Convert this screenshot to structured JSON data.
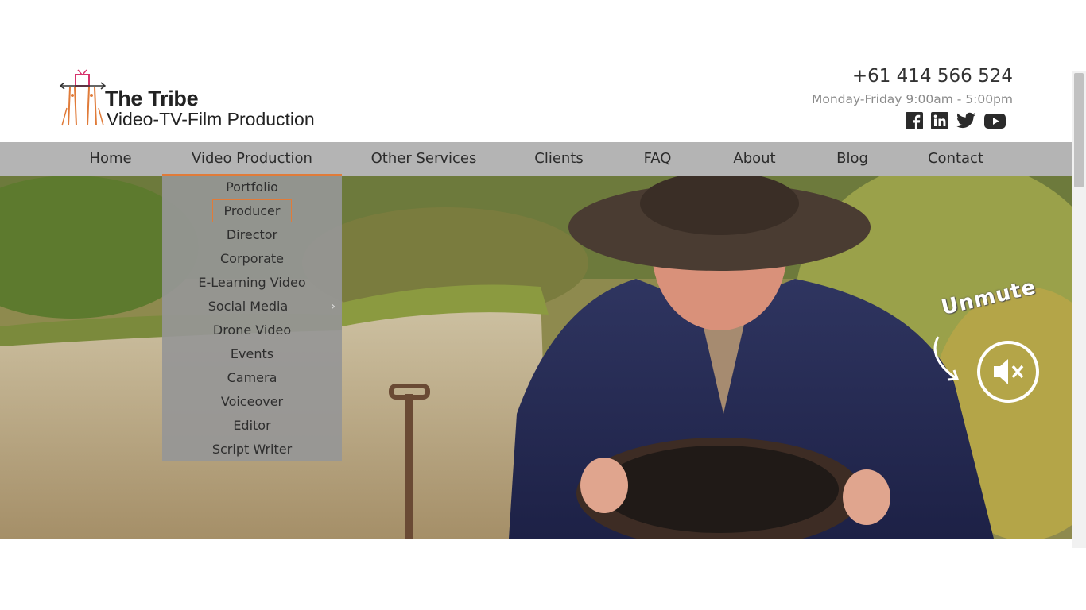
{
  "brand": {
    "title": "The Tribe",
    "subtitle": "Video-TV-Film Production",
    "logo_icon": "tribe-logo-figure"
  },
  "contact": {
    "phone": "+61 414 566 524",
    "hours": "Monday-Friday  9:00am - 5:00pm"
  },
  "social": [
    {
      "name": "facebook-icon"
    },
    {
      "name": "linkedin-icon"
    },
    {
      "name": "twitter-icon"
    },
    {
      "name": "youtube-icon"
    }
  ],
  "nav": {
    "items": [
      "Home",
      "Video Production",
      "Other Services",
      "Clients",
      "FAQ",
      "About",
      "Blog",
      "Contact"
    ],
    "active": "Video Production"
  },
  "dropdown": {
    "items": [
      "Portfolio",
      "Producer",
      "Director",
      "Corporate",
      "E-Learning Video",
      "Social Media",
      "Drone Video",
      "Events",
      "Camera",
      "Voiceover",
      "Editor",
      "Script Writer"
    ],
    "focused": "Producer",
    "has_submenu": "Social Media"
  },
  "video": {
    "unmute_label": "Unmute",
    "mute_icon": "speaker-muted-icon"
  },
  "colors": {
    "accent": "#e07b39",
    "nav_bg": "#b4b4b4",
    "dropdown_bg": "#969696"
  }
}
